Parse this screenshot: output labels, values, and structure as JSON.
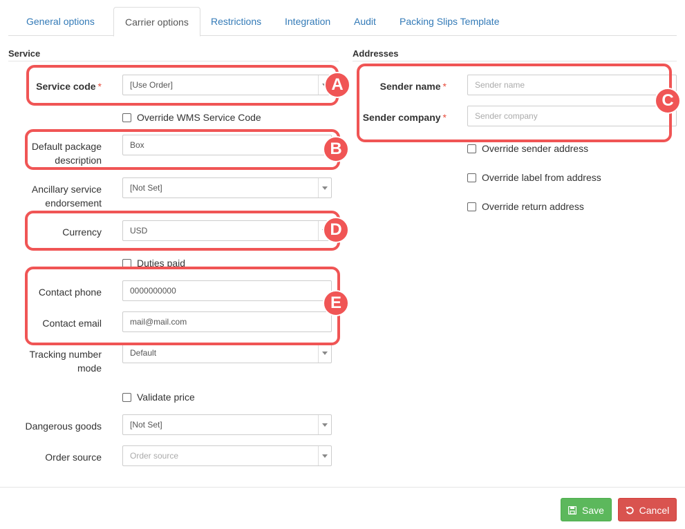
{
  "tabs": [
    {
      "label": "General options",
      "active": false
    },
    {
      "label": "Carrier options",
      "active": true
    },
    {
      "label": "Restrictions",
      "active": false
    },
    {
      "label": "Integration",
      "active": false
    },
    {
      "label": "Audit",
      "active": false
    },
    {
      "label": "Packing Slips Template",
      "active": false
    }
  ],
  "service": {
    "title": "Service",
    "service_code": {
      "label": "Service code",
      "required": "*",
      "value": "[Use Order]"
    },
    "override_wms": {
      "label": "Override WMS Service Code",
      "checked": false
    },
    "default_package": {
      "label_line1": "Default package",
      "label_line2": "description",
      "value": "Box"
    },
    "ancillary": {
      "label_line1": "Ancillary service",
      "label_line2": "endorsement",
      "value": "[Not Set]"
    },
    "currency": {
      "label": "Currency",
      "value": "USD"
    },
    "duties_paid": {
      "label": "Duties paid",
      "checked": false
    },
    "contact_phone": {
      "label": "Contact phone",
      "value": "0000000000"
    },
    "contact_email": {
      "label": "Contact email",
      "value": "mail@mail.com"
    },
    "tracking_mode": {
      "label_line1": "Tracking number",
      "label_line2": "mode",
      "value": "Default"
    },
    "validate_price": {
      "label": "Validate price",
      "checked": false
    },
    "dangerous_goods": {
      "label": "Dangerous goods",
      "value": "[Not Set]"
    },
    "order_source": {
      "label": "Order source",
      "placeholder": "Order source"
    }
  },
  "addresses": {
    "title": "Addresses",
    "sender_name": {
      "label": "Sender name",
      "required": "*",
      "placeholder": "Sender name"
    },
    "sender_company": {
      "label": "Sender company",
      "required": "*",
      "placeholder": "Sender company"
    },
    "override_sender": {
      "label": "Override sender address",
      "checked": false
    },
    "override_label_from": {
      "label": "Override label from address",
      "checked": false
    },
    "override_return": {
      "label": "Override return address",
      "checked": false
    }
  },
  "annotations": [
    "A",
    "B",
    "C",
    "D",
    "E"
  ],
  "footer": {
    "save_label": "Save",
    "cancel_label": "Cancel"
  },
  "colors": {
    "highlight": "#f05555",
    "link": "#337ab7",
    "save": "#5cb85c",
    "cancel": "#d9534f",
    "required": "#e74c3c"
  }
}
